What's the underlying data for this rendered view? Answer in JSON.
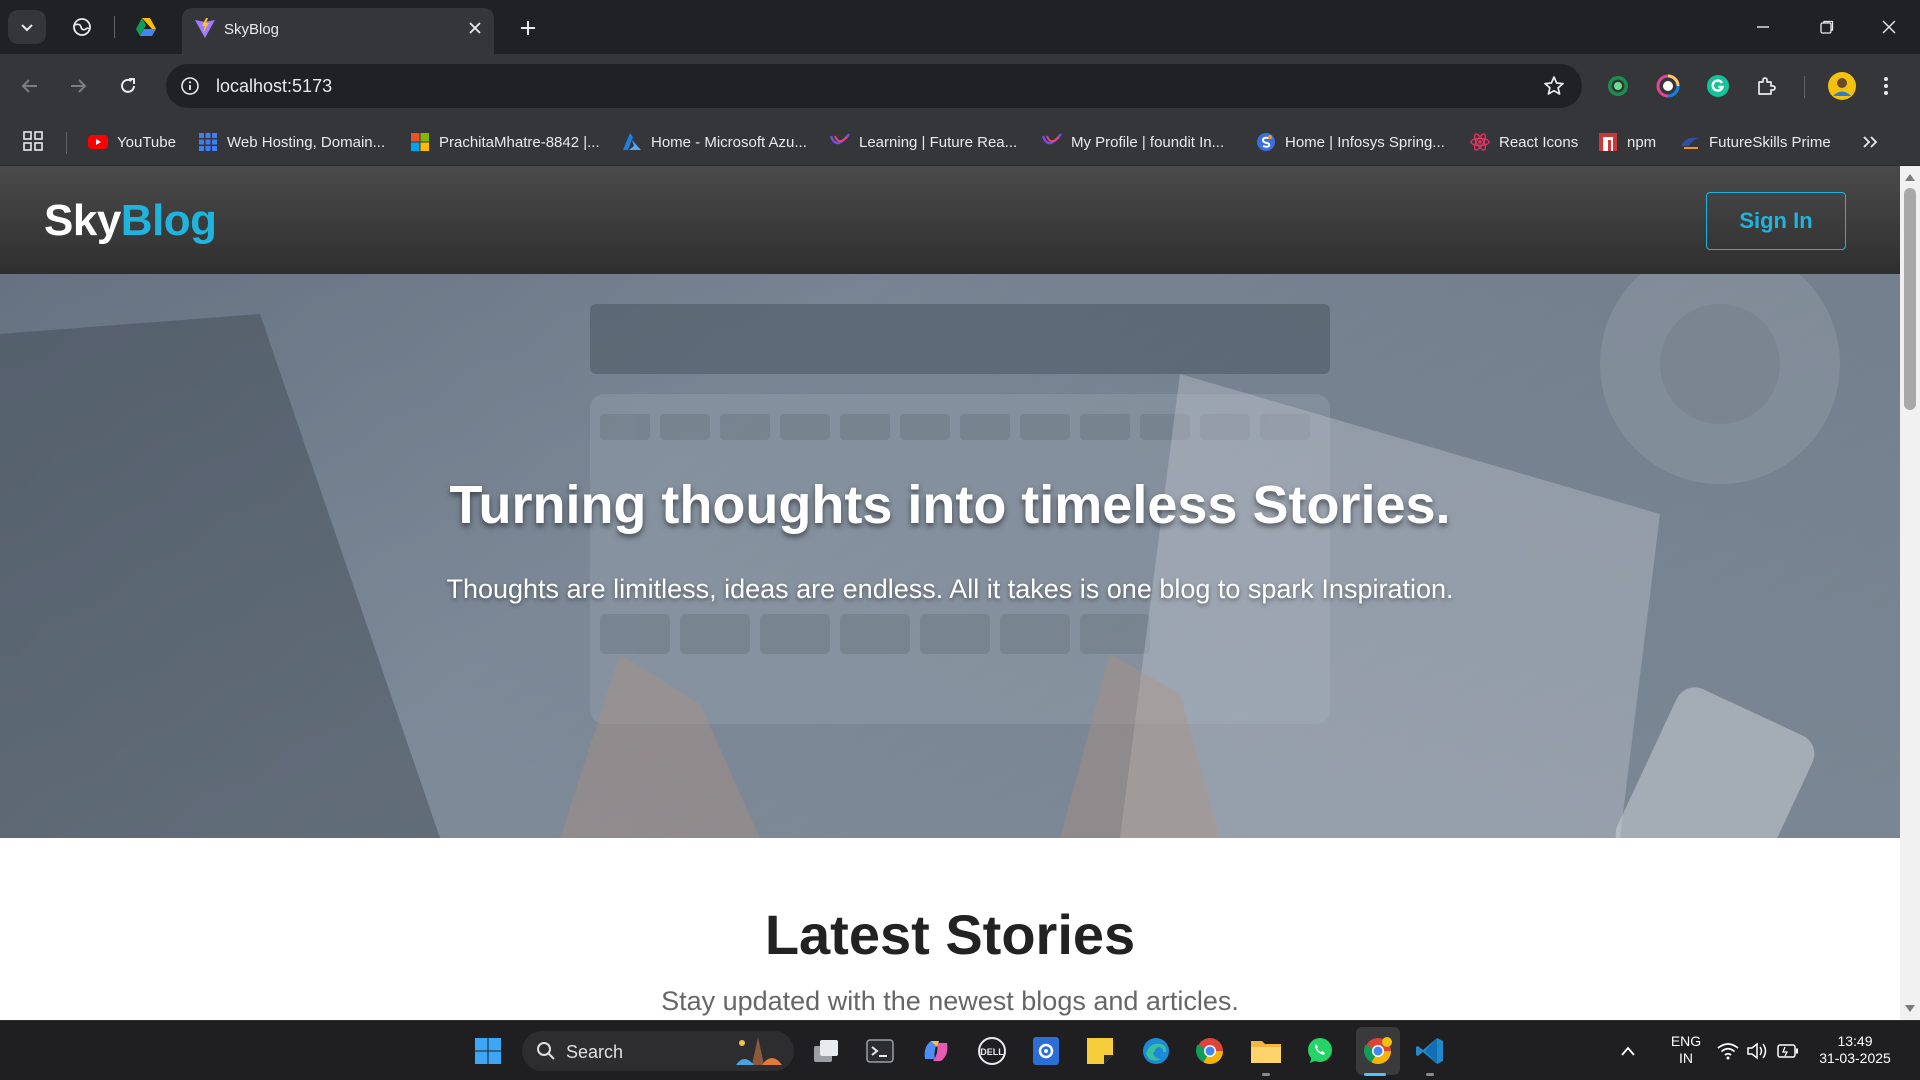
{
  "browser": {
    "tab_title": "SkyBlog",
    "url": "localhost:5173"
  },
  "bookmarks": [
    {
      "label": "YouTube"
    },
    {
      "label": "Web Hosting, Domain..."
    },
    {
      "label": "PrachitaMhatre-8842 |..."
    },
    {
      "label": "Home - Microsoft Azu..."
    },
    {
      "label": "Learning | Future Rea..."
    },
    {
      "label": "My Profile | foundit In..."
    },
    {
      "label": "Home | Infosys Spring..."
    },
    {
      "label": "React Icons"
    },
    {
      "label": "npm"
    },
    {
      "label": "FutureSkills Prime"
    }
  ],
  "site": {
    "logo_part1": "Sky",
    "logo_part2": "Blog",
    "signin_label": "Sign In",
    "hero_title": "Turning thoughts into timeless Stories.",
    "hero_subtitle": "Thoughts are limitless, ideas are endless. All it takes is one blog to spark Inspiration.",
    "latest_title": "Latest Stories",
    "latest_subtitle": "Stay updated with the newest blogs and articles."
  },
  "colors": {
    "accent": "#1fb4dd"
  },
  "taskbar": {
    "search_label": "Search",
    "lang_line1": "ENG",
    "lang_line2": "IN",
    "time": "13:49",
    "date": "31-03-2025"
  }
}
